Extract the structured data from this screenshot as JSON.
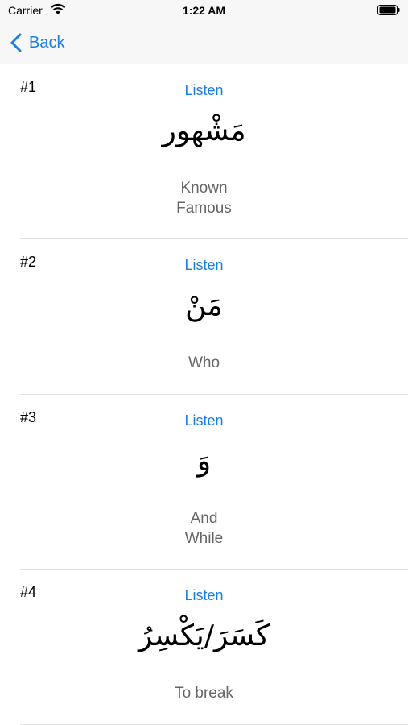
{
  "status_bar": {
    "carrier": "Carrier",
    "time": "1:22 AM"
  },
  "nav": {
    "back_label": "Back"
  },
  "words": [
    {
      "number": "#1",
      "listen": "Listen",
      "arabic": "مَشْهور",
      "meaning": [
        "Known",
        "Famous"
      ]
    },
    {
      "number": "#2",
      "listen": "Listen",
      "arabic": "مَنْ",
      "meaning": [
        "Who"
      ]
    },
    {
      "number": "#3",
      "listen": "Listen",
      "arabic": "وَ",
      "meaning": [
        "And",
        "While"
      ]
    },
    {
      "number": "#4",
      "listen": "Listen",
      "arabic": "كَسَرَ/يَكْسِرُ",
      "meaning": [
        "To break"
      ]
    }
  ],
  "colors": {
    "accent": "#1a7fe0",
    "meaning_text": "#666666",
    "bar_background": "#f7f7f7"
  }
}
